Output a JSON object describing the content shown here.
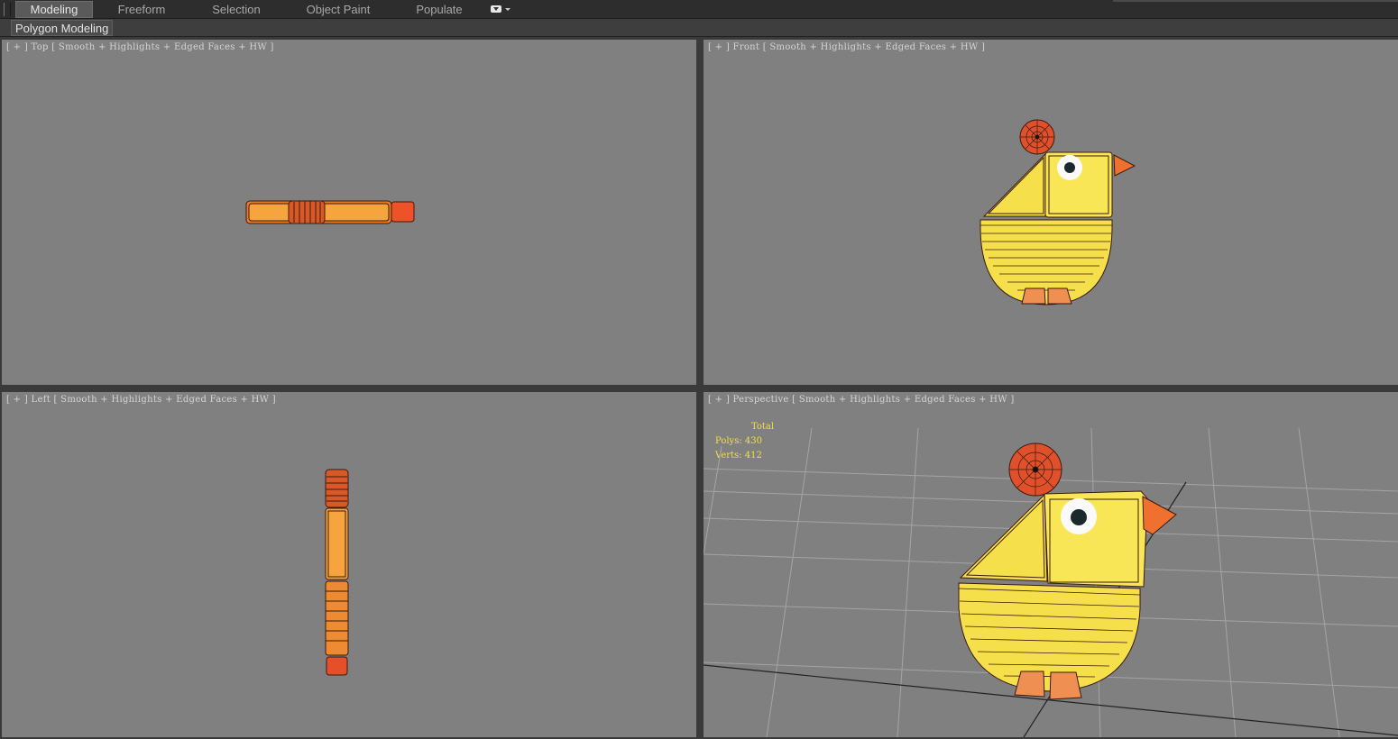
{
  "ribbon": {
    "tabs": [
      {
        "label": "Modeling",
        "active": true
      },
      {
        "label": "Freeform",
        "active": false
      },
      {
        "label": "Selection",
        "active": false
      },
      {
        "label": "Object Paint",
        "active": false
      },
      {
        "label": "Populate",
        "active": false
      }
    ],
    "panel_label": "Polygon Modeling"
  },
  "viewports": {
    "top": {
      "plus": "[ + ]",
      "view": "Top",
      "shading": "[ Smooth + Highlights + Edged Faces + HW ]"
    },
    "front": {
      "plus": "[ + ]",
      "view": "Front",
      "shading": "[ Smooth + Highlights + Edged Faces + HW ]"
    },
    "left": {
      "plus": "[ + ]",
      "view": "Left",
      "shading": "[ Smooth + Highlights + Edged Faces + HW ]"
    },
    "perspective": {
      "plus": "[ + ]",
      "view": "Perspective",
      "shading": "[ Smooth + Highlights + Edged Faces + HW ]"
    }
  },
  "stats": {
    "header": "Total",
    "polys_label": "Polys:",
    "polys": "430",
    "verts_label": "Verts:",
    "verts": "412"
  },
  "colors": {
    "viewport_bg": "#808080",
    "yellow": "#f7df50",
    "orange": "#f08a30",
    "red_orange": "#e0502a",
    "stats_text": "#f0e040"
  }
}
